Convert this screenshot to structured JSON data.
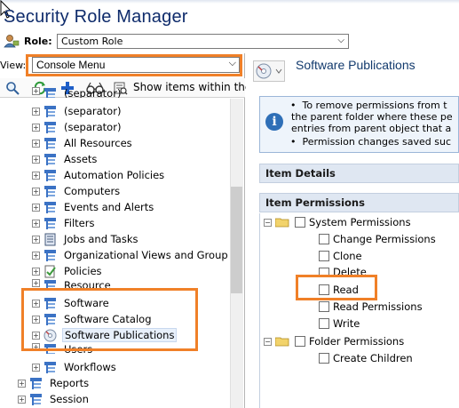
{
  "app": {
    "title": "Security Role Manager"
  },
  "role": {
    "label": "Role:",
    "value": "Custom Role"
  },
  "view": {
    "label": "View:",
    "value": "Console Menu"
  },
  "toolbar": {
    "show_items_label": "Show items within the"
  },
  "tree": {
    "items": [
      {
        "label": "(separator)"
      },
      {
        "label": "(separator)"
      },
      {
        "label": "(separator)"
      },
      {
        "label": "All Resources"
      },
      {
        "label": "Assets"
      },
      {
        "label": "Automation Policies"
      },
      {
        "label": "Computers"
      },
      {
        "label": "Events and Alerts"
      },
      {
        "label": "Filters"
      },
      {
        "label": "Jobs and Tasks"
      },
      {
        "label": "Organizational Views and Group"
      },
      {
        "label": "Policies"
      },
      {
        "label": "Resource"
      },
      {
        "label": "Software"
      },
      {
        "label": "Software Catalog"
      },
      {
        "label": "Software Publications"
      },
      {
        "label": "Users"
      },
      {
        "label": "Workflows"
      },
      {
        "label": "Reports"
      },
      {
        "label": "Session"
      }
    ]
  },
  "right": {
    "title": "Software Publications",
    "info_lines": [
      "To remove permissions from t",
      "the parent folder where these pe",
      "entries from parent object that a",
      "Permission changes saved suc"
    ],
    "item_details_label": "Item Details",
    "item_permissions_label": "Item Permissions",
    "permissions": {
      "system_label": "System Permissions",
      "change_permissions": "Change Permissions",
      "clone": "Clone",
      "delete": "Delete",
      "read": "Read",
      "read_permissions": "Read Permissions",
      "write": "Write",
      "folder_label": "Folder Permissions",
      "create_children": "Create Children"
    }
  },
  "colors": {
    "highlight": "#f08028",
    "title": "#0e2b6b",
    "accent": "#2f6fb7"
  }
}
